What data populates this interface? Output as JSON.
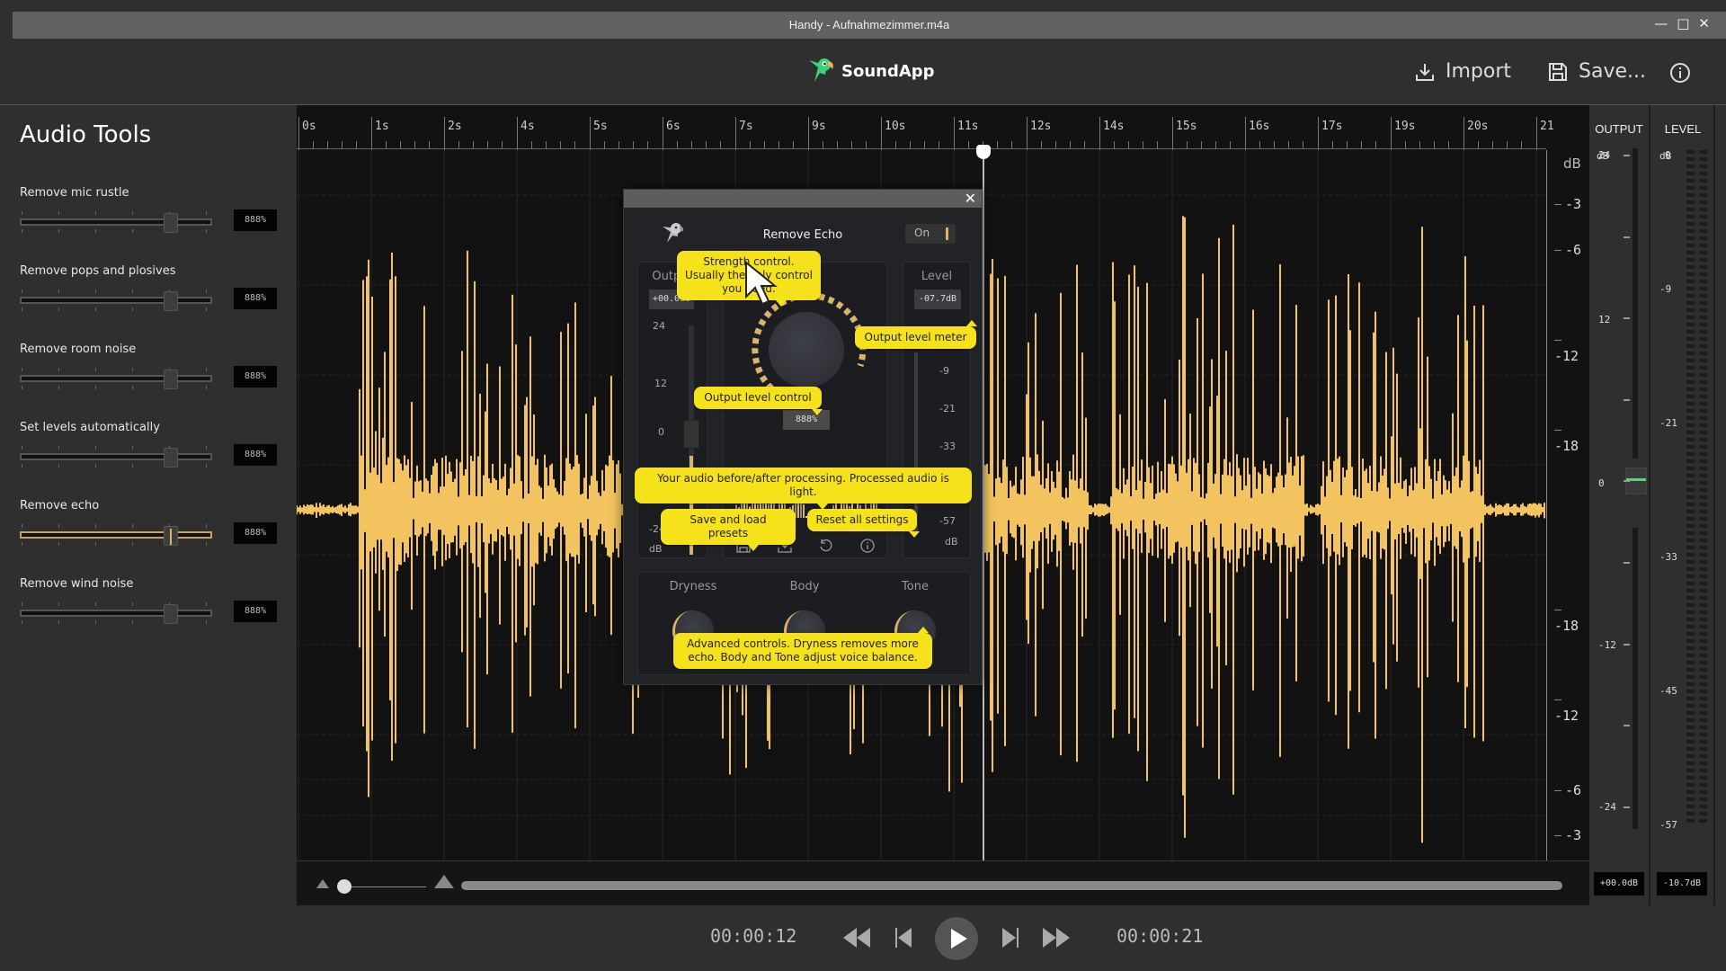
{
  "window": {
    "title": "Handy - Aufnahmezimmer.m4a",
    "controls": [
      "minimize",
      "maximize",
      "close"
    ]
  },
  "header": {
    "app_name": "SoundApp",
    "import_label": "Import",
    "save_label": "Save...",
    "info_icon": "info-icon"
  },
  "sidebar": {
    "title": "Audio Tools",
    "tools": [
      {
        "label": "Remove mic rustle",
        "value": "888%",
        "slider_fraction": 0.8,
        "active": false
      },
      {
        "label": "Remove pops and plosives",
        "value": "888%",
        "slider_fraction": 0.8,
        "active": false
      },
      {
        "label": "Remove room noise",
        "value": "888%",
        "slider_fraction": 0.8,
        "active": false
      },
      {
        "label": "Set levels automatically",
        "value": "888%",
        "slider_fraction": 0.8,
        "active": false
      },
      {
        "label": "Remove echo",
        "value": "888%",
        "slider_fraction": 0.8,
        "active": true
      },
      {
        "label": "Remove wind noise",
        "value": "888%",
        "slider_fraction": 0.8,
        "active": false
      }
    ]
  },
  "timeline": {
    "labels": [
      "0s",
      "1s",
      "2s",
      "4s",
      "5s",
      "6s",
      "7s",
      "9s",
      "10s",
      "11s",
      "12s",
      "14s",
      "15s",
      "16s",
      "17s",
      "19s",
      "20s",
      "21"
    ],
    "playhead_time_s": 11.6,
    "db_unit": "dB",
    "db_labels": [
      "-3",
      "-6",
      "-12",
      "-18",
      "",
      "-18",
      "-12",
      "-6",
      "-3"
    ]
  },
  "meters": {
    "output": {
      "title": "OUTPUT",
      "unit": "dB",
      "scale": [
        "24",
        "12",
        "0",
        "-12",
        "-24"
      ],
      "value_db": 0,
      "readout": "+00.0dB"
    },
    "level": {
      "title": "LEVEL",
      "unit": "dB",
      "scale": [
        "0",
        "-9",
        "-21",
        "-33",
        "-45",
        "-57"
      ],
      "readout": "-10.7dB"
    }
  },
  "transport": {
    "current_time": "00:00:12",
    "total_time": "00:00:21",
    "buttons": [
      "rewind",
      "previous",
      "play",
      "next",
      "fast-forward"
    ]
  },
  "zoom": {
    "zoom_fraction": 0.0
  },
  "dialog": {
    "name": "Remove Echo",
    "toggle_label": "On",
    "output_panel": {
      "title": "Output",
      "readout": "+00.0dB",
      "scale": [
        "24",
        "12",
        "0",
        "-24"
      ],
      "unit": "dB"
    },
    "strength_panel": {
      "title": "Strength",
      "readout": "888%"
    },
    "level_panel": {
      "title": "Level",
      "readout": "-07.7dB",
      "scale": [
        "-9",
        "-21",
        "-33",
        "-57"
      ],
      "unit": "dB"
    },
    "advanced": {
      "knobs": [
        "Dryness",
        "Body",
        "Tone"
      ]
    },
    "icons": [
      "save-icon",
      "load-icon",
      "reset-icon",
      "info-icon"
    ],
    "tooltips": {
      "strength": "Strength control. Usually the only control you need.",
      "output_meter": "Output level meter",
      "output_control": "Output level control",
      "before_after": "Your audio before/after processing. Processed audio is light.",
      "presets": "Save and load presets",
      "reset": "Reset all settings",
      "advanced": "Advanced controls. Dryness removes more echo. Body and Tone adjust voice balance."
    }
  },
  "colors": {
    "waveform": "#f2c35e",
    "accent": "#d8b36c",
    "tooltip": "#f5e21a",
    "meter_green": "#5fd17a"
  }
}
